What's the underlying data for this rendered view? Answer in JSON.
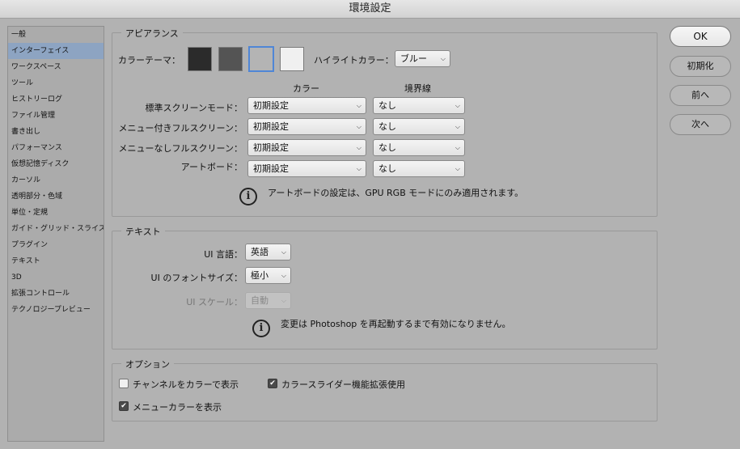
{
  "window": {
    "title": "環境設定"
  },
  "sidebar": {
    "items": [
      {
        "label": "一般",
        "active": false
      },
      {
        "label": "インターフェイス",
        "active": true
      },
      {
        "label": "ワークスペース",
        "active": false
      },
      {
        "label": "ツール",
        "active": false
      },
      {
        "label": "ヒストリーログ",
        "active": false
      },
      {
        "label": "ファイル管理",
        "active": false
      },
      {
        "label": "書き出し",
        "active": false
      },
      {
        "label": "パフォーマンス",
        "active": false
      },
      {
        "label": "仮想記憶ディスク",
        "active": false
      },
      {
        "label": "カーソル",
        "active": false
      },
      {
        "label": "透明部分・色域",
        "active": false
      },
      {
        "label": "単位・定規",
        "active": false
      },
      {
        "label": "ガイド・グリッド・スライス",
        "active": false
      },
      {
        "label": "プラグイン",
        "active": false
      },
      {
        "label": "テキスト",
        "active": false
      },
      {
        "label": "3D",
        "active": false
      },
      {
        "label": "拡張コントロール",
        "active": false
      },
      {
        "label": "テクノロジープレビュー",
        "active": false
      }
    ]
  },
  "appearance": {
    "title": "アピアランス",
    "color_theme_label": "カラーテーマ：",
    "swatches": [
      {
        "color": "#2b2b2b",
        "selected": false
      },
      {
        "color": "#545454",
        "selected": false
      },
      {
        "color": "#b4b4b4",
        "selected": true
      },
      {
        "color": "#f0f0f0",
        "selected": false
      }
    ],
    "highlight_label": "ハイライトカラー：",
    "highlight_value": "ブルー",
    "col_color": "カラー",
    "col_border": "境界線",
    "rows": [
      {
        "label": "標準スクリーンモード：",
        "color": "初期設定",
        "border": "なし"
      },
      {
        "label": "メニュー付きフルスクリーン：",
        "color": "初期設定",
        "border": "なし"
      },
      {
        "label": "メニューなしフルスクリーン：",
        "color": "初期設定",
        "border": "なし"
      },
      {
        "label": "アートボード：",
        "color": "初期設定",
        "border": "なし"
      }
    ],
    "note": "アートボードの設定は、GPU RGB モードにのみ適用されます。"
  },
  "text_section": {
    "title": "テキスト",
    "ui_language_label": "UI 言語：",
    "ui_language_value": "英語",
    "ui_font_size_label": "UI のフォントサイズ：",
    "ui_font_size_value": "極小",
    "ui_scale_label": "UI スケール：",
    "ui_scale_value": "自動",
    "note": "変更は Photoshop を再起動するまで有効になりません。"
  },
  "options": {
    "title": "オプション",
    "channels_color_label": "チャンネルをカラーで表示",
    "channels_color_checked": false,
    "color_slider_label": "カラースライダー機能拡張使用",
    "color_slider_checked": true,
    "menu_color_label": "メニューカラーを表示",
    "menu_color_checked": true
  },
  "buttons": {
    "ok": "OK",
    "reset": "初期化",
    "prev": "前へ",
    "next": "次へ"
  },
  "icons": {
    "info": "info-icon",
    "dropdown": "chevron-down-icon",
    "check": "checkmark-icon"
  }
}
